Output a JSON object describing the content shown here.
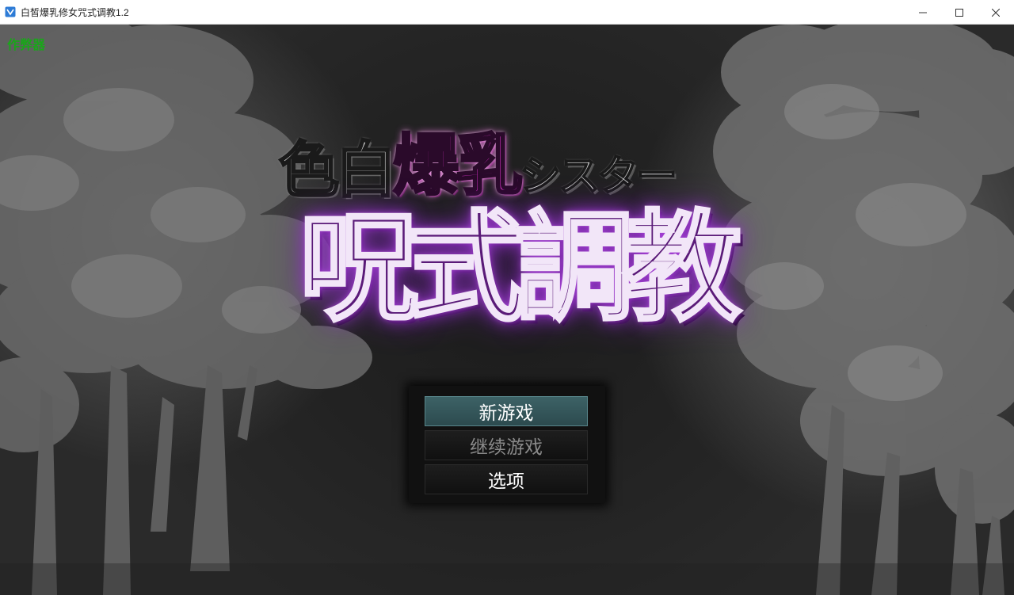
{
  "window": {
    "title": "白皙爆乳修女咒式调教1.2",
    "icons": [
      "app-icon",
      "minimize-icon",
      "maximize-icon",
      "close-icon"
    ]
  },
  "overlay": {
    "cheat_label": "作弊器"
  },
  "logo": {
    "part1": "色白",
    "part2": "爆乳",
    "part3": "シスター",
    "main": "呪式調教"
  },
  "menu": {
    "new_game": "新游戏",
    "continue": "继续游戏",
    "options": "选项"
  },
  "colors": {
    "cheat_label": "#1aa51a",
    "logo_pink": "#d030c0",
    "logo_purple": "#5a1a78",
    "menu_selected": "#3d6266"
  }
}
